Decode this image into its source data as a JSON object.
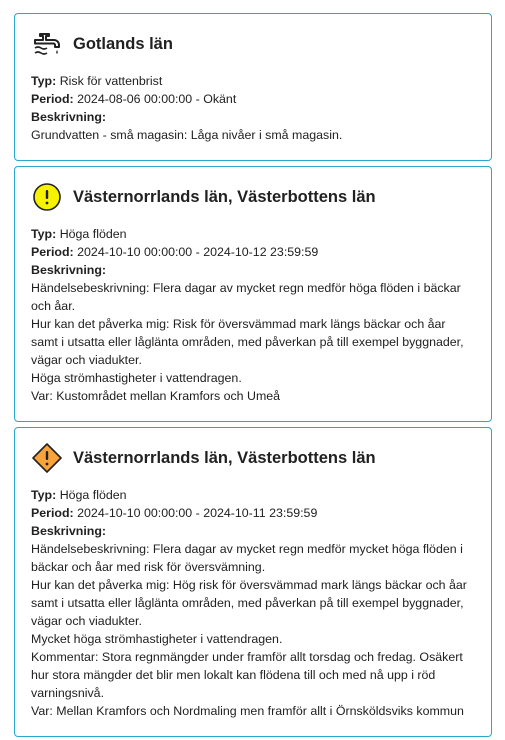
{
  "labels": {
    "type": "Typ:",
    "period": "Period:",
    "description": "Beskrivning:"
  },
  "cards": [
    {
      "title": "Gotlands län",
      "icon": "water-tap-icon",
      "type": "Risk för vattenbrist",
      "period": "2024-08-06 00:00:00 - Okänt",
      "description": [
        "Grundvatten - små magasin: Låga nivåer i små magasin."
      ]
    },
    {
      "title": "Västernorrlands län, Västerbottens län",
      "icon": "yellow-warning-icon",
      "icon_color": "#f7f200",
      "type": "Höga flöden",
      "period": "2024-10-10 00:00:00 - 2024-10-12 23:59:59",
      "description": [
        "Händelsebeskrivning: Flera dagar av mycket regn medför höga flöden i bäckar",
        "och åar.",
        "Hur kan det påverka mig: Risk för översvämmad mark längs bäckar och åar",
        "samt i utsatta eller låglänta områden, med påverkan på till exempel byggnader,",
        "vägar och viadukter.",
        "Höga strömhastigheter i vattendragen.",
        "Var: Kustområdet mellan Kramfors och Umeå"
      ]
    },
    {
      "title": "Västernorrlands län, Västerbottens län",
      "icon": "orange-warning-icon",
      "icon_color": "#f8a43a",
      "type": "Höga flöden",
      "period": "2024-10-10 00:00:00 - 2024-10-11 23:59:59",
      "description": [
        "Händelsebeskrivning: Flera dagar av mycket regn medför mycket höga flöden i",
        "bäckar och åar med risk för översvämning.",
        "Hur kan det påverka mig: Hög risk för översvämmad mark längs bäckar och åar",
        "samt i utsatta eller låglänta områden, med påverkan på till exempel byggnader,",
        "vägar och viadukter.",
        "Mycket höga strömhastigheter i vattendragen.",
        "Kommentar: Stora regnmängder under framför allt torsdag och fredag. Osäkert",
        "hur stora mängder det blir men lokalt kan flödena till och med nå upp i röd",
        "varningsnivå.",
        "Var: Mellan Kramfors och Nordmaling men framför allt i Örnsköldsviks kommun"
      ]
    }
  ]
}
